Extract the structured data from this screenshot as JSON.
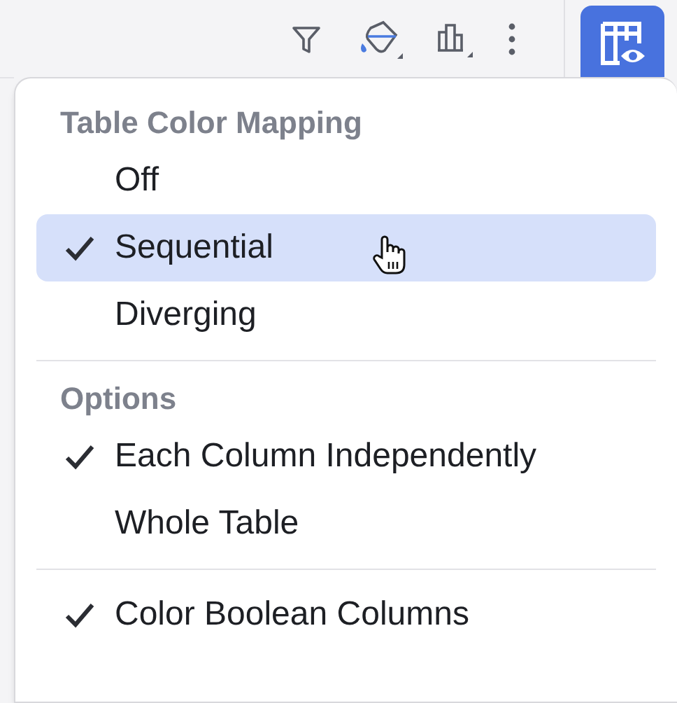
{
  "menu": {
    "sections": [
      {
        "title": "Table Color Mapping",
        "items": [
          {
            "label": "Off",
            "checked": false,
            "selected": false
          },
          {
            "label": "Sequential",
            "checked": true,
            "selected": true
          },
          {
            "label": "Diverging",
            "checked": false,
            "selected": false
          }
        ]
      },
      {
        "title": "Options",
        "items": [
          {
            "label": "Each Column Independently",
            "checked": true,
            "selected": false
          },
          {
            "label": "Whole Table",
            "checked": false,
            "selected": false
          }
        ]
      },
      {
        "items": [
          {
            "label": "Color Boolean Columns",
            "checked": true,
            "selected": false
          }
        ]
      }
    ]
  }
}
